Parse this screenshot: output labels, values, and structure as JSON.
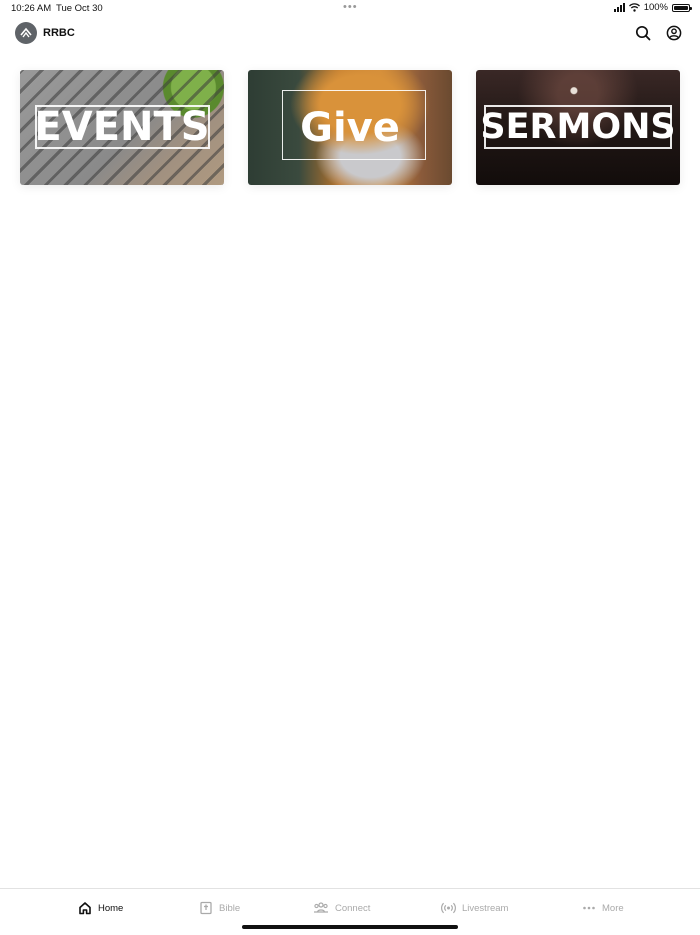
{
  "status_bar": {
    "time": "10:26 AM",
    "date": "Tue Oct 30",
    "battery": "100%",
    "battery_level": 1.0
  },
  "header": {
    "title": "RRBC"
  },
  "cards": [
    {
      "label": "EVENTS"
    },
    {
      "label": "Give"
    },
    {
      "label": "SERMONS"
    }
  ],
  "tabs": [
    {
      "label": "Home",
      "icon": "home-icon",
      "active": true
    },
    {
      "label": "Bible",
      "icon": "bible-icon",
      "active": false
    },
    {
      "label": "Connect",
      "icon": "people-icon",
      "active": false
    },
    {
      "label": "Livestream",
      "icon": "broadcast-icon",
      "active": false
    },
    {
      "label": "More",
      "icon": "more-dots-icon",
      "active": false
    }
  ],
  "colors": {
    "active_tab": "#111111",
    "inactive_tab": "#aaaaaa",
    "logo_bg": "#5f6368"
  }
}
